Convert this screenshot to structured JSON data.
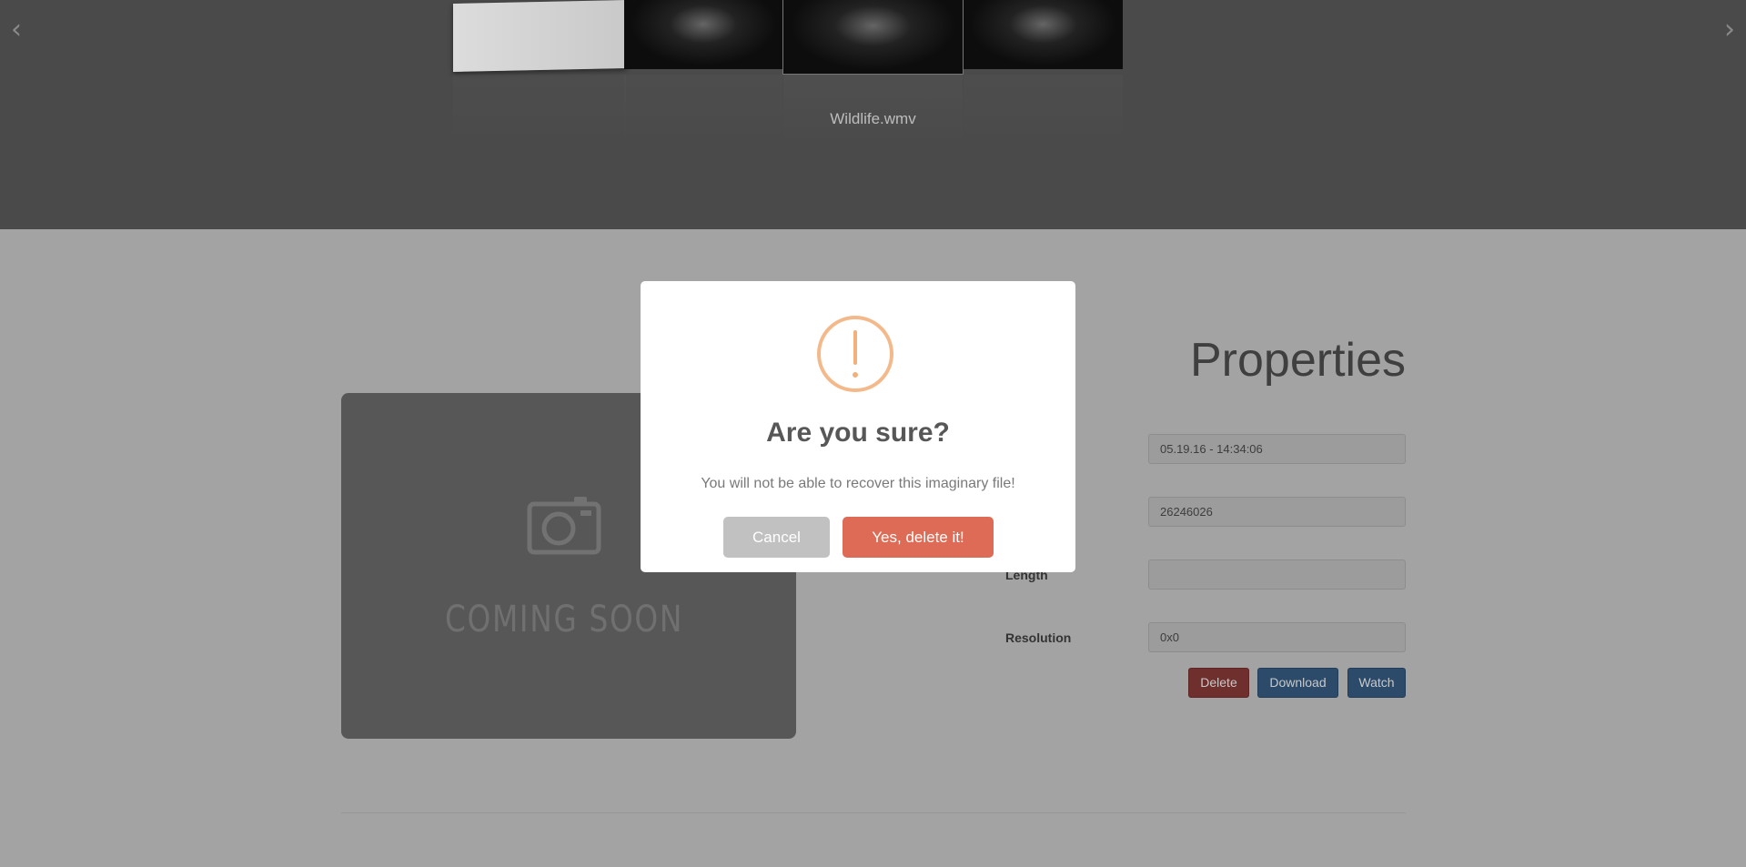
{
  "coverflow": {
    "prev_arrow": "‹",
    "next_arrow": "›",
    "current_title": "Wildlife.wmv"
  },
  "preview": {
    "placeholder_text": "COMING SOON",
    "icon": "camera-icon"
  },
  "properties": {
    "title": "Properties",
    "fields": [
      {
        "label": "",
        "value": "05.19.16 - 14:34:06"
      },
      {
        "label": "",
        "value": "26246026"
      },
      {
        "label": "Length",
        "value": ""
      },
      {
        "label": "Resolution",
        "value": "0x0"
      }
    ]
  },
  "actions": {
    "delete_label": "Delete",
    "download_label": "Download",
    "watch_label": "Watch"
  },
  "dialog": {
    "icon": "warning-icon",
    "title": "Are you sure?",
    "text": "You will not be able to recover this imaginary file!",
    "cancel_label": "Cancel",
    "confirm_label": "Yes, delete it!"
  },
  "colors": {
    "warning": "#f8bb86",
    "confirm": "#dd6b55",
    "cancel": "#c1c1c1",
    "danger": "#d9534f",
    "primary": "#337ab7"
  }
}
